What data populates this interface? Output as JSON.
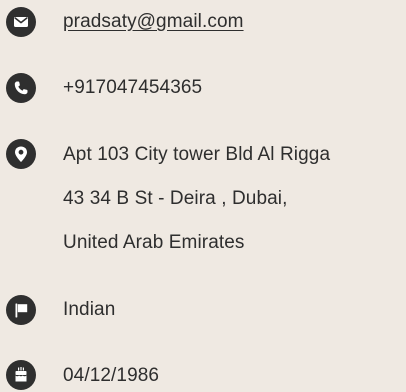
{
  "contact": {
    "email": {
      "icon": "envelope-icon",
      "value": "pradsaty@gmail.com"
    },
    "phone": {
      "icon": "phone-icon",
      "value": "+917047454365"
    },
    "address": {
      "icon": "map-marker-icon",
      "lines": [
        "Apt 103 City tower Bld Al Rigga",
        "43 34 B St - Deira , Dubai,",
        "United Arab Emirates"
      ]
    },
    "nationality": {
      "icon": "flag-icon",
      "value": "Indian"
    },
    "birthdate": {
      "icon": "birthday-cake-icon",
      "value": "04/12/1986"
    }
  },
  "colors": {
    "background": "#efe9e2",
    "icon_circle": "#2f2f2f",
    "text": "#2e2e2e"
  }
}
